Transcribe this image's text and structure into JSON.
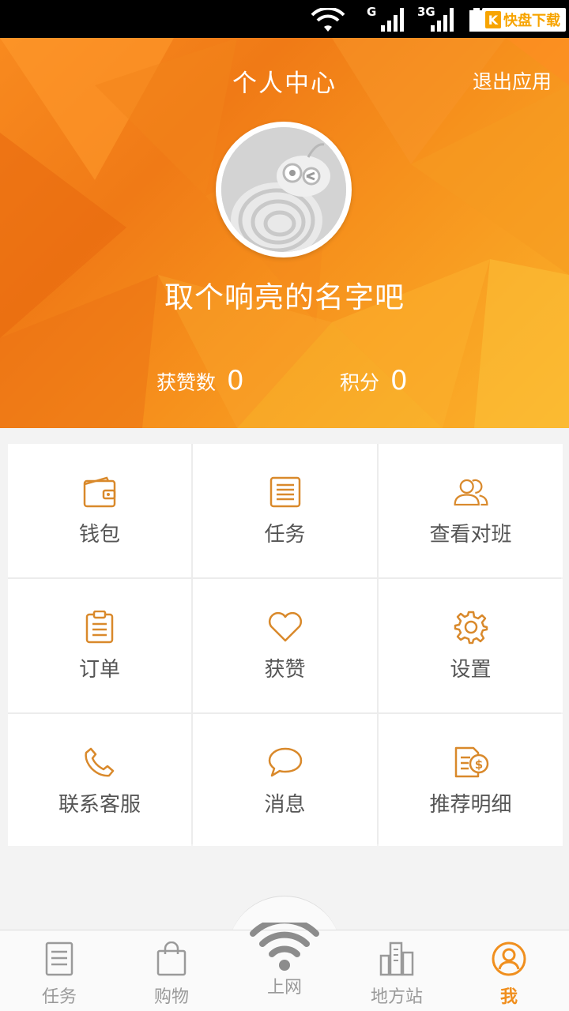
{
  "header": {
    "title": "个人中心",
    "exit_label": "退出应用",
    "nickname": "取个响亮的名字吧",
    "likes_label": "获赞数",
    "likes_value": "0",
    "points_label": "积分",
    "points_value": "0"
  },
  "grid": [
    {
      "label": "钱包",
      "icon": "wallet-icon"
    },
    {
      "label": "任务",
      "icon": "task-list-icon"
    },
    {
      "label": "查看对班",
      "icon": "users-icon"
    },
    {
      "label": "订单",
      "icon": "clipboard-icon"
    },
    {
      "label": "获赞",
      "icon": "heart-icon"
    },
    {
      "label": "设置",
      "icon": "gear-icon"
    },
    {
      "label": "联系客服",
      "icon": "phone-icon"
    },
    {
      "label": "消息",
      "icon": "chat-bubble-icon"
    },
    {
      "label": "推荐明细",
      "icon": "document-dollar-icon"
    }
  ],
  "bottom_nav": [
    {
      "label": "任务",
      "icon": "document-icon",
      "active": false
    },
    {
      "label": "购物",
      "icon": "shopping-bag-icon",
      "active": false
    },
    {
      "label": "上网",
      "icon": "wifi-icon",
      "active": false
    },
    {
      "label": "地方站",
      "icon": "buildings-icon",
      "active": false
    },
    {
      "label": "我",
      "icon": "user-circle-icon",
      "active": true
    }
  ],
  "status_bar": {
    "network_1": "G",
    "network_2": "3G",
    "watermark_k": "K",
    "watermark_text": "快盘下载"
  },
  "colors": {
    "accent": "#f08f1e",
    "icon": "#d9892b",
    "header_start": "#f07a16",
    "header_end": "#fbb22a",
    "inactive": "#9a9a9a"
  }
}
